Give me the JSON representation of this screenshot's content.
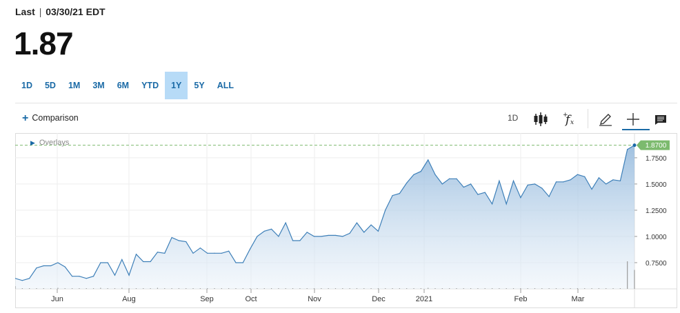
{
  "header": {
    "last_label": "Last",
    "separator": "|",
    "date": "03/30/21 EDT",
    "price": "1.87"
  },
  "ranges": [
    {
      "label": "1D",
      "active": false
    },
    {
      "label": "5D",
      "active": false
    },
    {
      "label": "1M",
      "active": false
    },
    {
      "label": "3M",
      "active": false
    },
    {
      "label": "6M",
      "active": false
    },
    {
      "label": "YTD",
      "active": false
    },
    {
      "label": "1Y",
      "active": true
    },
    {
      "label": "5Y",
      "active": false
    },
    {
      "label": "ALL",
      "active": false
    }
  ],
  "toolbar": {
    "comparison_label": "Comparison",
    "interval_label": "1D",
    "icons": [
      "candlestick-icon",
      "function-icon",
      "pencil-icon",
      "crosshair-icon",
      "comment-icon"
    ]
  },
  "overlays_label": "Overlays",
  "colors": {
    "accent": "#1a6aa6",
    "line": "#3d7fb8",
    "active_range": "#b7dbf7",
    "last_badge": "#7cba6e"
  },
  "chart_data": {
    "type": "area",
    "title": "",
    "xlabel": "",
    "ylabel": "",
    "y_axis_position": "right",
    "ylim": [
      0.5,
      1.92
    ],
    "yticks": [
      "0.7500",
      "1.0000",
      "1.2500",
      "1.5000",
      "1.7500"
    ],
    "xticks": [
      "Jun",
      "Aug",
      "Sep",
      "Oct",
      "Nov",
      "Dec",
      "2021",
      "Feb",
      "Mar"
    ],
    "last_value_label": "1.8700",
    "grid": true,
    "series": [
      {
        "values": [
          0.6,
          0.58,
          0.6,
          0.7,
          0.72,
          0.72,
          0.75,
          0.71,
          0.62,
          0.62,
          0.6,
          0.62,
          0.75,
          0.75,
          0.63,
          0.78,
          0.63,
          0.83,
          0.76,
          0.76,
          0.85,
          0.84,
          0.99,
          0.96,
          0.95,
          0.84,
          0.89,
          0.84,
          0.84,
          0.84,
          0.86,
          0.75,
          0.75,
          0.88,
          1.0,
          1.05,
          1.07,
          1.0,
          1.13,
          0.96,
          0.96,
          1.04,
          1.0,
          1.0,
          1.01,
          1.01,
          1.0,
          1.03,
          1.13,
          1.04,
          1.11,
          1.05,
          1.25,
          1.39,
          1.41,
          1.51,
          1.59,
          1.62,
          1.73,
          1.59,
          1.5,
          1.55,
          1.55,
          1.47,
          1.5,
          1.4,
          1.42,
          1.31,
          1.53,
          1.31,
          1.53,
          1.37,
          1.49,
          1.5,
          1.46,
          1.38,
          1.52,
          1.52,
          1.54,
          1.59,
          1.57,
          1.45,
          1.56,
          1.5,
          1.54,
          1.53,
          1.83,
          1.87
        ]
      }
    ],
    "volume": [
      0.08,
      0.02,
      0.02,
      0.02,
      0.02,
      0.02,
      0.03,
      0.02,
      0.02,
      0.02,
      0.02,
      0.02,
      0.03,
      0.02,
      0.02,
      0.03,
      0.02,
      0.02,
      0.02,
      0.02,
      0.03,
      0.02,
      0.02,
      0.02,
      0.02,
      0.02,
      0.02,
      0.02,
      0.02,
      0.02,
      0.02,
      0.02,
      0.02,
      0.02,
      0.02,
      0.02,
      0.02,
      0.02,
      0.02,
      0.02,
      0.02,
      0.02,
      0.02,
      0.02,
      0.02,
      0.02,
      0.02,
      0.02,
      0.02,
      0.02,
      0.02,
      0.02,
      0.02,
      0.02,
      0.02,
      0.02,
      0.02,
      0.02,
      0.03,
      0.02,
      0.02,
      0.02,
      0.02,
      0.02,
      0.02,
      0.02,
      0.02,
      0.02,
      0.02,
      0.02,
      0.02,
      0.02,
      0.02,
      0.02,
      0.02,
      0.02,
      0.02,
      0.02,
      0.02,
      0.02,
      0.02,
      0.02,
      0.02,
      0.02,
      0.02,
      0.02,
      0.8,
      0.55
    ]
  }
}
